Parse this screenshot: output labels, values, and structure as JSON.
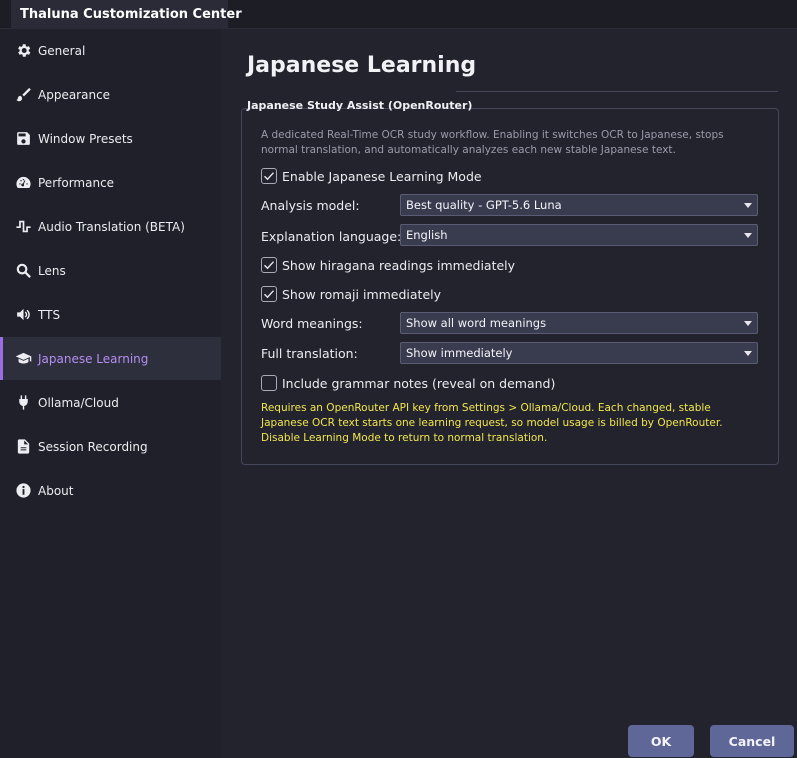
{
  "window": {
    "title": "Thaluna Customization Center"
  },
  "sidebar": {
    "items": [
      {
        "label": "General",
        "icon": "gear-icon"
      },
      {
        "label": "Appearance",
        "icon": "brush-icon"
      },
      {
        "label": "Window Presets",
        "icon": "save-icon"
      },
      {
        "label": "Performance",
        "icon": "gauge-icon"
      },
      {
        "label": "Audio Translation (BETA)",
        "icon": "waveform-icon"
      },
      {
        "label": "Lens",
        "icon": "search-icon"
      },
      {
        "label": "TTS",
        "icon": "speaker-icon"
      },
      {
        "label": "Japanese Learning",
        "icon": "graduation-cap-icon",
        "active": true
      },
      {
        "label": "Ollama/Cloud",
        "icon": "plug-icon"
      },
      {
        "label": "Session Recording",
        "icon": "document-icon"
      },
      {
        "label": "About",
        "icon": "info-icon"
      }
    ]
  },
  "main": {
    "title": "Japanese Learning",
    "group_title": "Japanese Study Assist (OpenRouter)",
    "description": "A dedicated Real-Time OCR study workflow. Enabling it switches OCR to Japanese, stops normal translation, and automatically analyzes each new stable Japanese text.",
    "enable_mode": {
      "label": "Enable Japanese Learning Mode",
      "checked": true
    },
    "analysis_model": {
      "label": "Analysis model:",
      "value": "Best quality - GPT-5.6 Luna"
    },
    "explanation_language": {
      "label": "Explanation language:",
      "value": "English"
    },
    "hiragana": {
      "label": "Show hiragana readings immediately",
      "checked": true
    },
    "romaji": {
      "label": "Show romaji immediately",
      "checked": true
    },
    "word_meanings": {
      "label": "Word meanings:",
      "value": "Show all word meanings"
    },
    "full_translation": {
      "label": "Full translation:",
      "value": "Show immediately"
    },
    "grammar": {
      "label": "Include grammar notes (reveal on demand)",
      "checked": false
    },
    "note": "Requires an OpenRouter API key from Settings > Ollama/Cloud. Each changed, stable Japanese OCR text starts one learning request, so model usage is billed by OpenRouter. Disable Learning Mode to return to normal translation."
  },
  "footer": {
    "ok_label": "OK",
    "cancel_label": "Cancel"
  },
  "colors": {
    "background": "#1f2029",
    "accent": "#9d6ee3",
    "active_text": "#b58ef0",
    "note_text": "#f2e64e",
    "button": "#5f6799"
  }
}
